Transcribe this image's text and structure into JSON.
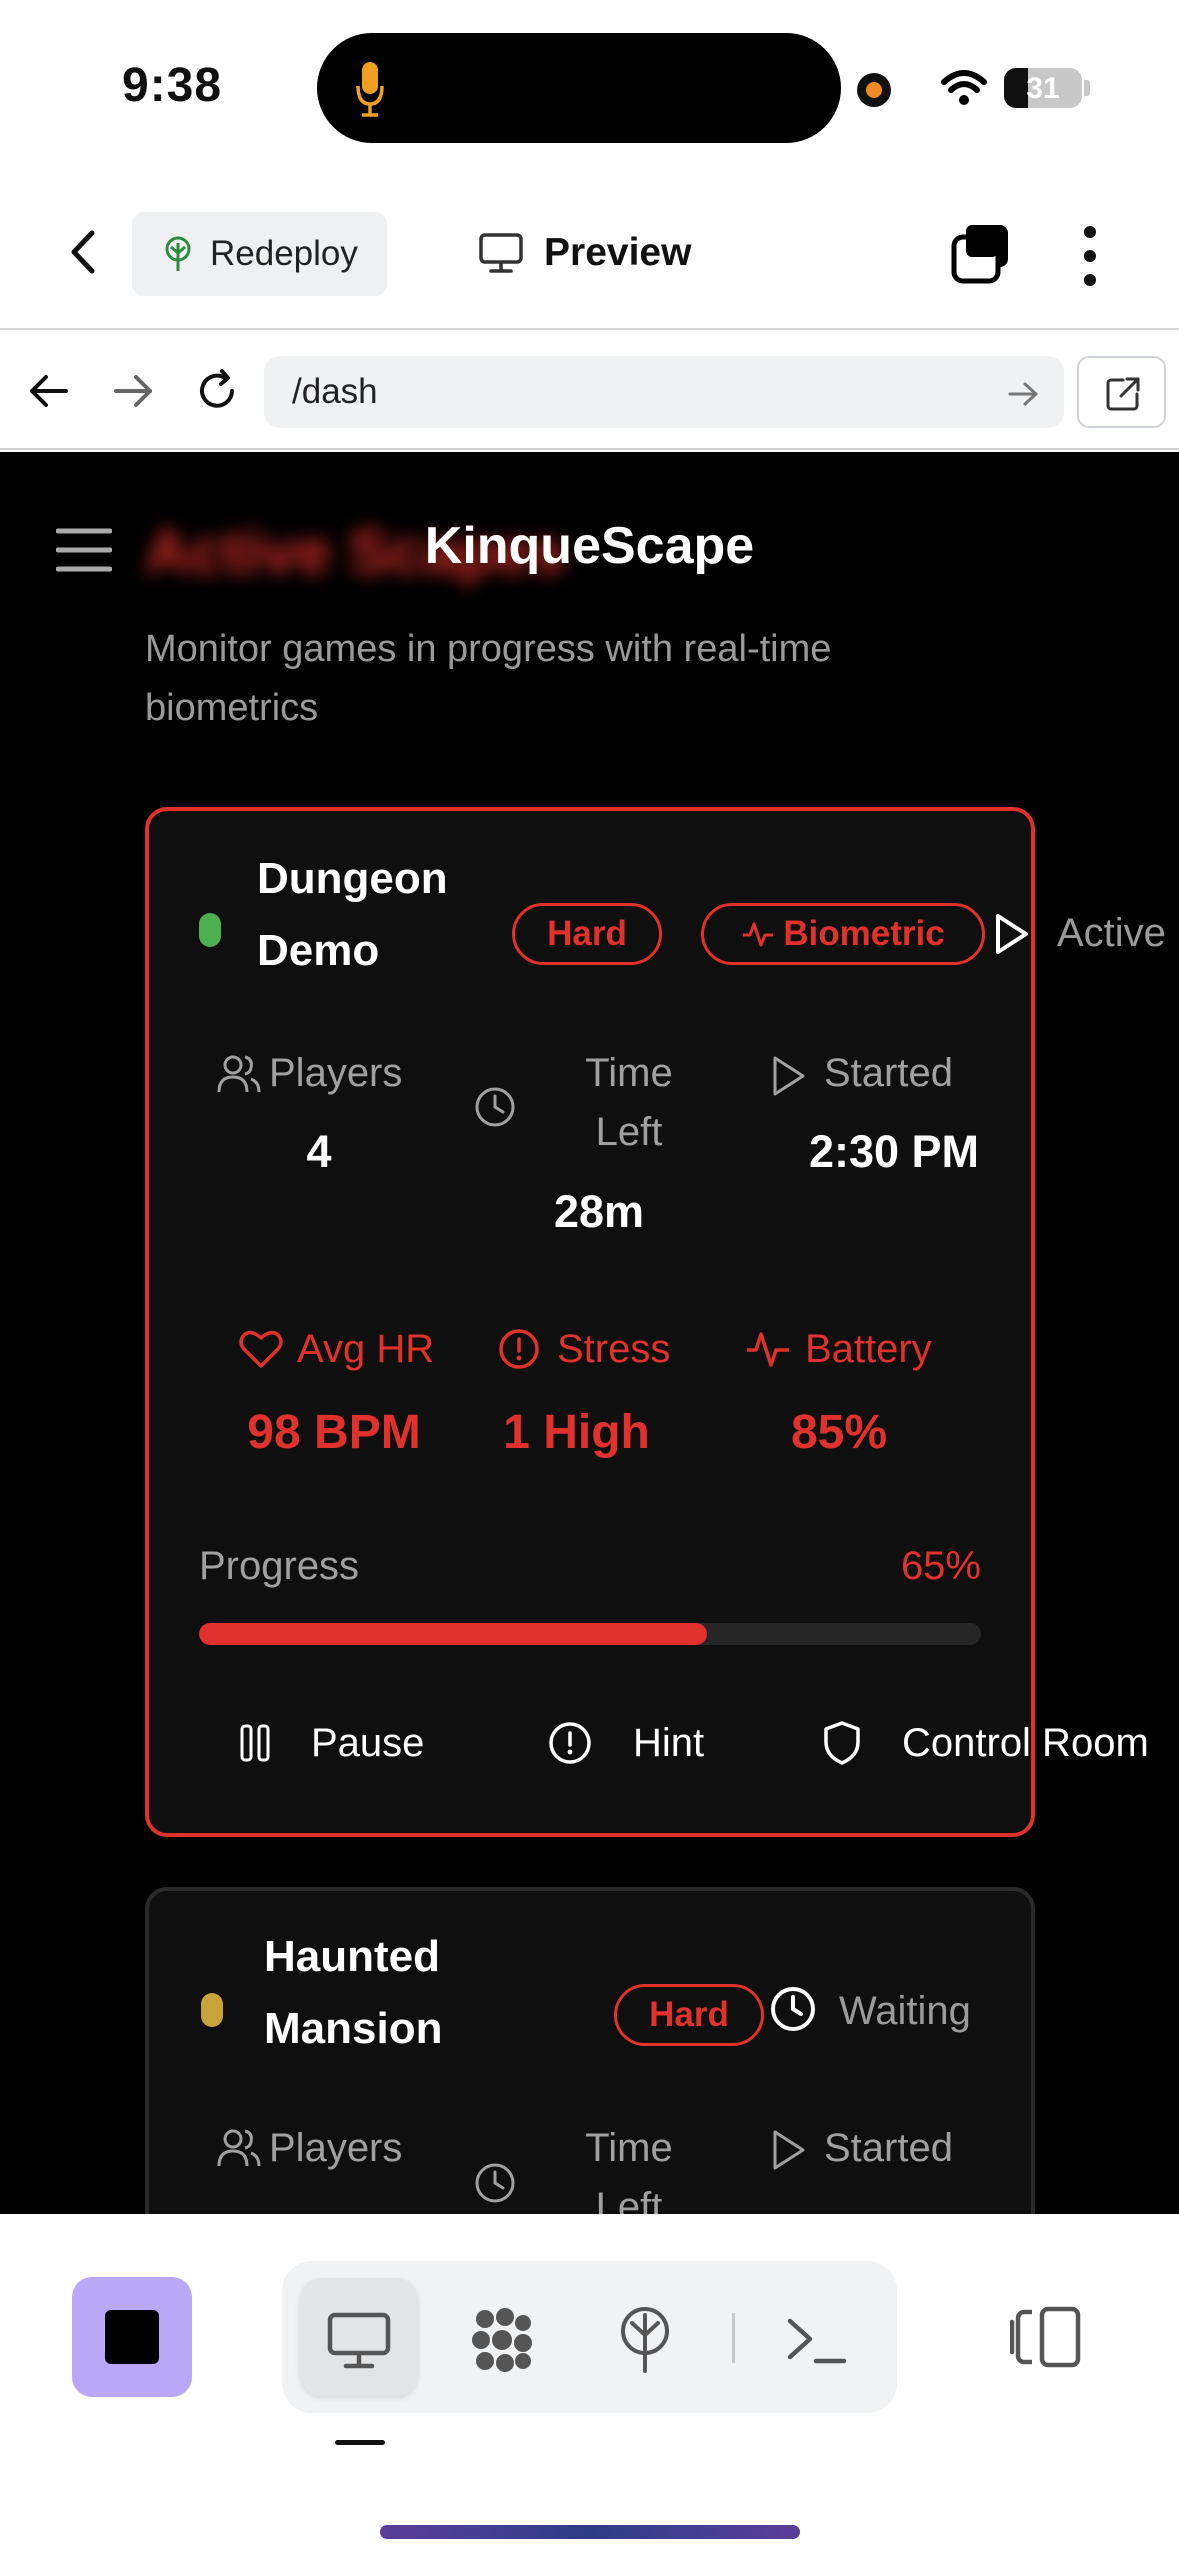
{
  "status_bar": {
    "time": "9:38",
    "battery": "31",
    "battery_level": 0.31
  },
  "toolbar": {
    "redeploy_label": "Redeploy",
    "preview_label": "Preview"
  },
  "urlbar": {
    "url": "/dash"
  },
  "app": {
    "brand": "KinqueScape",
    "heading": "Active Scapes",
    "subtitle": "Monitor games in progress with real-time biometrics"
  },
  "games": [
    {
      "name_line1": "Dungeon",
      "name_line2": "Demo",
      "difficulty": "Hard",
      "biometric_label": "Biometric",
      "status": "Active",
      "status_color": "#4caf50",
      "players_label": "Players",
      "players": "4",
      "time_left_line1": "Time",
      "time_left_line2": "Left",
      "time_left": "28m",
      "started_label": "Started",
      "started": "2:30 PM",
      "avg_hr_label": "Avg HR",
      "avg_hr": "98 BPM",
      "stress_label": "Stress",
      "stress": "1 High",
      "battery_label": "Battery",
      "battery": "85%",
      "progress_label": "Progress",
      "progress_text": "65%",
      "progress": 0.65,
      "actions": {
        "pause": "Pause",
        "hint": "Hint",
        "control_room": "Control Room"
      }
    },
    {
      "name_line1": "Haunted",
      "name_line2": "Mansion",
      "difficulty": "Hard",
      "status": "Waiting",
      "status_color": "#c9a23a",
      "players_label": "Players",
      "time_left_line1": "Time",
      "time_left_line2": "Left",
      "started_label": "Started"
    }
  ],
  "colors": {
    "accent": "#e0312c",
    "stop_button": "#b9a7f7"
  },
  "icons": [
    "microphone-icon",
    "wifi-icon",
    "back-chevron-icon",
    "redeploy-tree-icon",
    "monitor-icon",
    "tabs-icon",
    "more-vertical-icon",
    "arrow-left-icon",
    "arrow-right-icon",
    "reload-icon",
    "arrow-go-icon",
    "external-link-icon",
    "hamburger-icon",
    "users-icon",
    "clock-icon",
    "play-icon",
    "heart-icon",
    "alert-circle-icon",
    "activity-icon",
    "pause-icon",
    "shield-icon",
    "stop-icon",
    "network-icon",
    "antenna-icon",
    "terminal-icon",
    "split-view-icon"
  ]
}
